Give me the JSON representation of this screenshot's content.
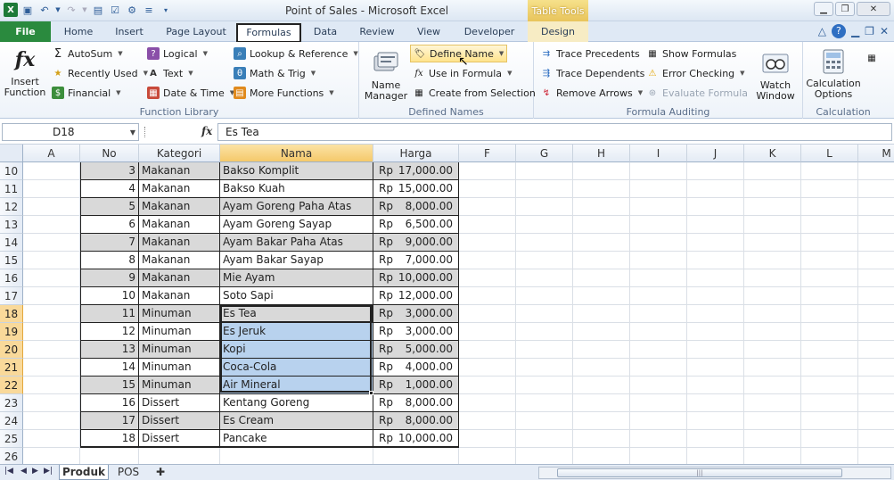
{
  "window": {
    "title": "Point of Sales  -  Microsoft Excel",
    "context_tab_group": "Table Tools"
  },
  "tabs": [
    "File",
    "Home",
    "Insert",
    "Page Layout",
    "Formulas",
    "Data",
    "Review",
    "View",
    "Developer",
    "Design"
  ],
  "ribbon": {
    "function_library": {
      "label": "Function Library",
      "insert_function": "Insert Function",
      "autosum": "AutoSum",
      "recently_used": "Recently Used",
      "financial": "Financial",
      "logical": "Logical",
      "text": "Text",
      "date_time": "Date & Time",
      "lookup": "Lookup & Reference",
      "math": "Math & Trig",
      "more": "More Functions"
    },
    "defined_names": {
      "label": "Defined Names",
      "name_manager": "Name Manager",
      "define_name": "Define Name",
      "use_in_formula": "Use in Formula",
      "create_from_selection": "Create from Selection"
    },
    "formula_auditing": {
      "label": "Formula Auditing",
      "trace_precedents": "Trace Precedents",
      "trace_dependents": "Trace Dependents",
      "remove_arrows": "Remove Arrows",
      "show_formulas": "Show Formulas",
      "error_checking": "Error Checking",
      "evaluate_formula": "Evaluate Formula",
      "watch_window": "Watch Window"
    },
    "calculation": {
      "label": "Calculation",
      "calculation_options": "Calculation Options"
    }
  },
  "formula_bar": {
    "name_box": "D18",
    "fx": "fx",
    "value": "Es Tea"
  },
  "columns": [
    "A",
    "No",
    "Kategori",
    "Nama",
    "Harga",
    "F",
    "G",
    "H",
    "I",
    "J",
    "K",
    "L",
    "M"
  ],
  "table_headers": [
    "No",
    "Kategori",
    "Nama",
    "Harga"
  ],
  "rows": [
    {
      "r": "10",
      "no": "3",
      "kat": "Makanan",
      "nama": "Bakso Komplit",
      "rp": "Rp",
      "harga": "17,000.00"
    },
    {
      "r": "11",
      "no": "4",
      "kat": "Makanan",
      "nama": "Bakso Kuah",
      "rp": "Rp",
      "harga": "15,000.00"
    },
    {
      "r": "12",
      "no": "5",
      "kat": "Makanan",
      "nama": "Ayam Goreng Paha Atas",
      "rp": "Rp",
      "harga": "8,000.00"
    },
    {
      "r": "13",
      "no": "6",
      "kat": "Makanan",
      "nama": "Ayam Goreng Sayap",
      "rp": "Rp",
      "harga": "6,500.00"
    },
    {
      "r": "14",
      "no": "7",
      "kat": "Makanan",
      "nama": "Ayam Bakar Paha Atas",
      "rp": "Rp",
      "harga": "9,000.00"
    },
    {
      "r": "15",
      "no": "8",
      "kat": "Makanan",
      "nama": "Ayam Bakar Sayap",
      "rp": "Rp",
      "harga": "7,000.00"
    },
    {
      "r": "16",
      "no": "9",
      "kat": "Makanan",
      "nama": "Mie Ayam",
      "rp": "Rp",
      "harga": "10,000.00"
    },
    {
      "r": "17",
      "no": "10",
      "kat": "Makanan",
      "nama": "Soto Sapi",
      "rp": "Rp",
      "harga": "12,000.00"
    },
    {
      "r": "18",
      "no": "11",
      "kat": "Minuman",
      "nama": "Es Tea",
      "rp": "Rp",
      "harga": "3,000.00"
    },
    {
      "r": "19",
      "no": "12",
      "kat": "Minuman",
      "nama": "Es Jeruk",
      "rp": "Rp",
      "harga": "3,000.00"
    },
    {
      "r": "20",
      "no": "13",
      "kat": "Minuman",
      "nama": "Kopi",
      "rp": "Rp",
      "harga": "5,000.00"
    },
    {
      "r": "21",
      "no": "14",
      "kat": "Minuman",
      "nama": "Coca-Cola",
      "rp": "Rp",
      "harga": "4,000.00"
    },
    {
      "r": "22",
      "no": "15",
      "kat": "Minuman",
      "nama": "Air Mineral",
      "rp": "Rp",
      "harga": "1,000.00"
    },
    {
      "r": "23",
      "no": "16",
      "kat": "Dissert",
      "nama": "Kentang Goreng",
      "rp": "Rp",
      "harga": "8,000.00"
    },
    {
      "r": "24",
      "no": "17",
      "kat": "Dissert",
      "nama": "Es Cream",
      "rp": "Rp",
      "harga": "8,000.00"
    },
    {
      "r": "25",
      "no": "18",
      "kat": "Dissert",
      "nama": "Pancake",
      "rp": "Rp",
      "harga": "10,000.00"
    },
    {
      "r": "26",
      "no": "",
      "kat": "",
      "nama": "",
      "rp": "",
      "harga": ""
    }
  ],
  "sheets": [
    "Produk",
    "POS"
  ],
  "colors": {
    "accent": "#2a8a3e",
    "selection": "#b8d2ee",
    "band": "#d9d9d9",
    "header_highlight": "#fcd97e"
  }
}
